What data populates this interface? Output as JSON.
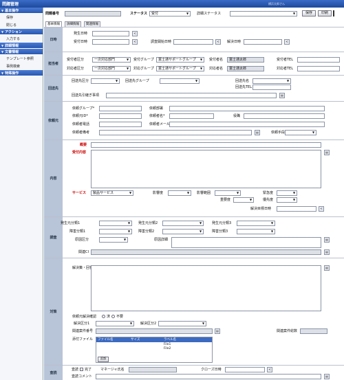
{
  "window": {
    "title": "問題管理",
    "user": "横浜太郎さん"
  },
  "sidebar": {
    "sections": [
      {
        "label": "基本操作",
        "items": [
          "保存",
          "閉じる"
        ]
      },
      {
        "label": "アクション",
        "items": [
          "入力する"
        ]
      },
      {
        "label": "詳細情報",
        "items": []
      },
      {
        "label": "文書情報",
        "items": [
          "テンプレート参照",
          "事例検索"
        ]
      },
      {
        "label": "特殊操作",
        "items": []
      }
    ]
  },
  "header": {
    "number_label": "問題番号",
    "status_label": "ステータス",
    "status_value": "受付",
    "detail_status_label": "詳細ステータス",
    "save": "保存",
    "print": "印刷"
  },
  "tabs": [
    "基本情報",
    "詳細情報",
    "関連情報"
  ],
  "date": {
    "section": "日時",
    "occurred": "発生日時",
    "received": "受付日時",
    "start": "調査開始日時",
    "resolved": "解決日時"
  },
  "owner": {
    "section": "担当者",
    "recv_section": "受付者区分",
    "recv_section_value": "一次対応部門",
    "recv_group": "受付グループ",
    "recv_group_value": "富士通サポートグループ",
    "recv_name": "受付者名",
    "recv_name_value": "富士通太郎",
    "recv_tel": "受付者TEL",
    "resp_section": "対応者区分",
    "resp_section_value": "一次対応部門",
    "resp_group": "対応グループ",
    "resp_group_value": "富士通サポートグループ",
    "resp_name": "対応者名",
    "resp_name_value": "富士通太郎",
    "resp_tel": "対応者TEL"
  },
  "route": {
    "section": "回送先",
    "division": "回送先区分",
    "group": "回送先グループ",
    "name": "回送先名",
    "tel": "回送先TEL",
    "notes": "回送先引継ぎ事項"
  },
  "requester": {
    "section": "依頼元",
    "group": "依頼グループ*",
    "dept": "依頼部署",
    "id": "依頼元ID*",
    "name": "依頼者名*",
    "post": "役職",
    "phone": "依頼者電話",
    "mail": "依頼者メール",
    "remarks": "依頼者備考",
    "method": "依頼手段"
  },
  "content": {
    "section": "内容",
    "summary": "概要",
    "detail": "受付内容",
    "service": "サービス",
    "service_value": "製品サービス",
    "category": "影響度",
    "range": "影響範囲",
    "urgency": "緊急度",
    "importance": "重要度",
    "priority": "優先度",
    "target_date": "解決目標日時"
  },
  "investigation": {
    "section": "調査",
    "cls1": "発生元分類1",
    "cls2": "発生元分類2",
    "cls3": "発生元分類3",
    "fault1": "障害分類1",
    "fault2": "障害分類2",
    "fault3": "障害分類3",
    "product": "原因区分",
    "detail": "原因詳細",
    "related": "関連CI"
  },
  "action": {
    "section": "対策",
    "answer": "解決策・回答",
    "confirm": "依頼元解決確認",
    "yes": "済",
    "no": "不要",
    "division1": "解決区分1",
    "division2": "解決区分2",
    "related_no": "関連案件番号",
    "related_count": "関連案件総数",
    "attach": "添付ファイル",
    "cols": [
      "ファイル名",
      "サイズ",
      "ラベル名"
    ],
    "rows": [
      "File1",
      "File2"
    ],
    "add": "追加"
  },
  "review": {
    "section": "査読",
    "label": "査読",
    "done": "完了",
    "manager": "マネージャ氏名",
    "close_date": "クローズ日時",
    "comment": "査読コメント"
  }
}
